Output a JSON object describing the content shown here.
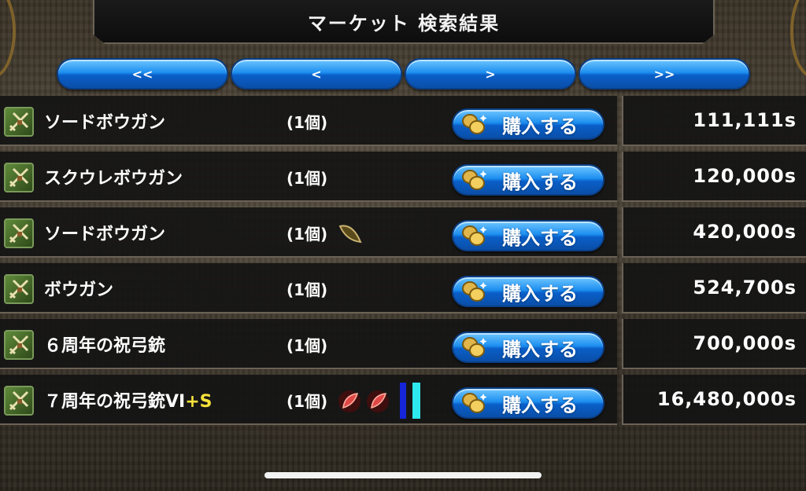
{
  "header": {
    "title": "マーケット 検索結果"
  },
  "nav": {
    "first": "<<",
    "prev": "<",
    "next": ">",
    "last": ">>"
  },
  "buy_label": "購入する",
  "rows": [
    {
      "name": "ソードボウガン",
      "suffix": "",
      "qty": "(1個)",
      "price": "111,111s"
    },
    {
      "name": "スクウレボウガン",
      "suffix": "",
      "qty": "(1個)",
      "price": "120,000s"
    },
    {
      "name": "ソードボウガン",
      "suffix": "",
      "qty": "(1個)",
      "price": "420,000s"
    },
    {
      "name": "ボウガン",
      "suffix": "",
      "qty": "(1個)",
      "price": "524,700s"
    },
    {
      "name": "６周年の祝弓銃",
      "suffix": "",
      "qty": "(1個)",
      "price": "700,000s"
    },
    {
      "name": "７周年の祝弓銃VI",
      "suffix": "+S",
      "qty": "(1個)",
      "price": "16,480,000s"
    }
  ],
  "colors": {
    "button_blue": "#1d8ff0",
    "suffix_yellow": "#f5e23a",
    "bar_blue": "#1525d8",
    "bar_cyan": "#2de8ec"
  },
  "icons": {
    "item": "crossbow-icon",
    "buy": "coin-icon",
    "seed": "seed-icon",
    "rune": "red-rune-icon"
  }
}
